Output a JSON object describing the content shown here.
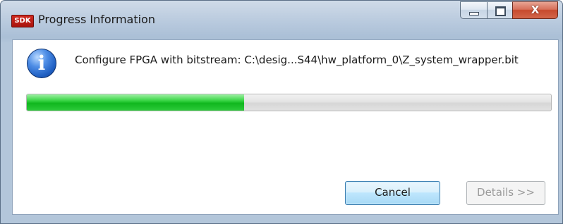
{
  "window": {
    "app_icon_text": "SDK",
    "title": "Progress Information",
    "caption": {
      "minimize_icon": "minimize-icon",
      "maximize_icon": "maximize-icon",
      "close_icon": "close-icon",
      "close_glyph": "X"
    }
  },
  "dialog": {
    "info_icon": "info-icon",
    "info_glyph": "i",
    "message": "Configure FPGA with bitstream: C:\\desig...S44\\hw_platform_0\\Z_system_wrapper.bit",
    "progress": {
      "fraction": 0.415,
      "fill_color": "#1fbf2c"
    }
  },
  "buttons": {
    "cancel_label": "Cancel",
    "details_label": "Details >>"
  }
}
